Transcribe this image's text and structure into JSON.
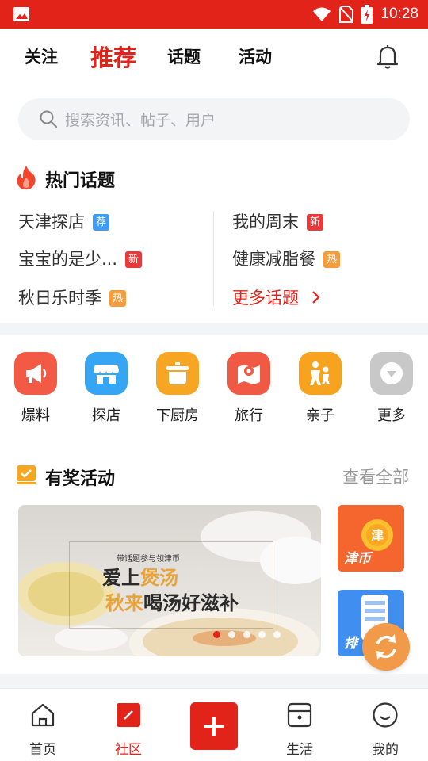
{
  "status_bar": {
    "time": "10:28"
  },
  "top_nav": {
    "tabs": [
      {
        "label": "关注"
      },
      {
        "label": "推荐",
        "active": true
      },
      {
        "label": "话题"
      },
      {
        "label": "活动"
      }
    ],
    "bell_icon": "bell-icon"
  },
  "search": {
    "placeholder": "搜索资讯、帖子、用户",
    "icon": "search-icon"
  },
  "hot_topics": {
    "title": "热门话题",
    "icon": "flame-icon",
    "left": [
      {
        "name": "天津探店",
        "badge": "荐",
        "badge_color": "#3e9bf3"
      },
      {
        "name": "宝宝的是少...",
        "badge": "新",
        "badge_color": "#e9393b"
      },
      {
        "name": "秋日乐时季",
        "badge": "热",
        "badge_color": "#f59c3c"
      }
    ],
    "right": [
      {
        "name": "我的周末",
        "badge": "新",
        "badge_color": "#e9393b"
      },
      {
        "name": "健康减脂餐",
        "badge": "热",
        "badge_color": "#f59c3c"
      }
    ],
    "more": "更多话题"
  },
  "categories": [
    {
      "label": "爆料",
      "icon": "megaphone-icon",
      "color": "#f35a45"
    },
    {
      "label": "探店",
      "icon": "shop-icon",
      "color": "#36a6f4"
    },
    {
      "label": "下厨房",
      "icon": "pot-icon",
      "color": "#f6a623"
    },
    {
      "label": "旅行",
      "icon": "map-icon",
      "color": "#f05a44"
    },
    {
      "label": "亲子",
      "icon": "family-icon",
      "color": "#f8a31f"
    },
    {
      "label": "更多",
      "icon": "chevron-down-icon",
      "color": "#c8c8c8"
    }
  ],
  "activities": {
    "title": "有奖活动",
    "icon": "ticket-icon",
    "view_all": "查看全部",
    "banner": {
      "small_text": "带话题参与领津币",
      "line1_a": "爱上",
      "line1_b": "煲汤",
      "line2_a": "秋来",
      "line2_b": "喝汤好滋补",
      "slide_count": 5,
      "active_slide": 1
    },
    "side_cards": [
      {
        "label": "津币",
        "color": "#f2532b"
      },
      {
        "label": "排",
        "color": "#3f8ef0"
      }
    ]
  },
  "bottom_nav": [
    {
      "label": "首页",
      "icon": "home-icon"
    },
    {
      "label": "社区",
      "icon": "community-icon",
      "active": true
    },
    {
      "label": "",
      "icon": "plus-icon"
    },
    {
      "label": "生活",
      "icon": "box-icon"
    },
    {
      "label": "我的",
      "icon": "smile-icon"
    }
  ],
  "colors": {
    "brand": "#e2231a",
    "accent_orange": "#f19a4a"
  }
}
